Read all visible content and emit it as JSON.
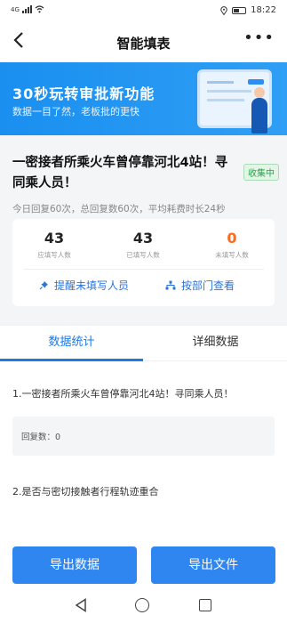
{
  "status_bar": {
    "network": "4G",
    "time": "18:22"
  },
  "header": {
    "title": "智能填表"
  },
  "banner": {
    "title": "30秒玩转审批新功能",
    "subtitle": "数据一目了然，老板批的更快"
  },
  "form": {
    "title": "一密接者所乘火车曾停靠河北4站！寻同乘人员！",
    "status": "收集中",
    "summary": "今日回复60次，总回复数60次，平均耗费时长24秒"
  },
  "stats": [
    {
      "value": "43",
      "label": "应填写人数"
    },
    {
      "value": "43",
      "label": "已填写人数"
    },
    {
      "value": "0",
      "label": "未填写人数"
    }
  ],
  "actions": {
    "remind": "提醒未填写人员",
    "by_dept": "按部门查看"
  },
  "tabs": [
    {
      "label": "数据统计",
      "active": true
    },
    {
      "label": "详细数据",
      "active": false
    }
  ],
  "questions": [
    {
      "title": "1.一密接者所乘火车曾停靠河北4站！寻同乘人员！",
      "answer": "回复数：0"
    },
    {
      "title": "2.是否与密切接触者行程轨迹重合"
    }
  ],
  "buttons": {
    "export_data": "导出数据",
    "export_file": "导出文件"
  },
  "colors": {
    "primary": "#2f86f0",
    "accent_orange": "#ff6a1a",
    "status_green": "#2ba24c"
  }
}
